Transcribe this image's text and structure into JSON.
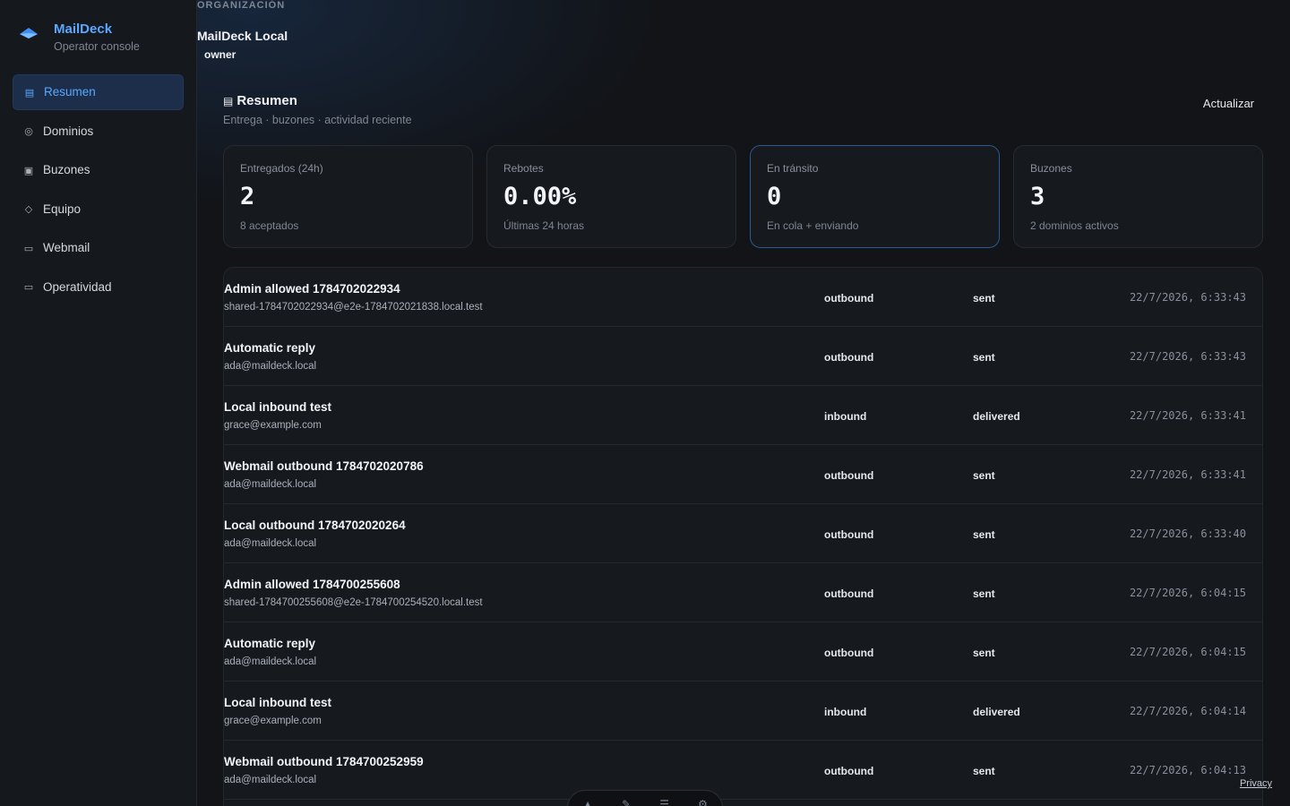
{
  "app": {
    "name": "MailDeck",
    "subtitle": "Operator console",
    "accent": "#5aa8ff"
  },
  "nav": [
    {
      "label": "Resumen",
      "icon": "list-icon",
      "glyph": "▤",
      "active": true
    },
    {
      "label": "Dominios",
      "icon": "globe-icon",
      "glyph": "◎",
      "active": false
    },
    {
      "label": "Buzones",
      "icon": "mailbox-icon",
      "glyph": "▣",
      "active": false
    },
    {
      "label": "Equipo",
      "icon": "team-icon",
      "glyph": "◇",
      "active": false
    },
    {
      "label": "Webmail",
      "icon": "webmail-icon",
      "glyph": "▭",
      "active": false
    },
    {
      "label": "Operatividad",
      "icon": "operations-icon",
      "glyph": "▭",
      "active": false
    }
  ],
  "org": {
    "label": "ORGANIZACIÓN",
    "name": "MailDeck Local",
    "role": "owner"
  },
  "section": {
    "title": "Resumen",
    "subtitle": "Entrega · buzones · actividad reciente",
    "refresh": "Actualizar"
  },
  "cards": [
    {
      "label": "Entregados (24h)",
      "value": "2",
      "note": "8 aceptados"
    },
    {
      "label": "Rebotes",
      "value": "0.00%",
      "note": "Últimas 24 horas"
    },
    {
      "label": "En tránsito",
      "value": "0",
      "note": "En cola + enviando"
    },
    {
      "label": "Buzones",
      "value": "3",
      "note": "2 dominios activos"
    }
  ],
  "messages": [
    {
      "subject": "Admin allowed 1784702022934",
      "from": "shared-1784702022934@e2e-1784702021838.local.test",
      "direction": "outbound",
      "status": "sent",
      "time": "22/7/2026, 6:33:43"
    },
    {
      "subject": "Automatic reply",
      "from": "ada@maildeck.local",
      "direction": "outbound",
      "status": "sent",
      "time": "22/7/2026, 6:33:43"
    },
    {
      "subject": "Local inbound test",
      "from": "grace@example.com",
      "direction": "inbound",
      "status": "delivered",
      "time": "22/7/2026, 6:33:41"
    },
    {
      "subject": "Webmail outbound 1784702020786",
      "from": "ada@maildeck.local",
      "direction": "outbound",
      "status": "sent",
      "time": "22/7/2026, 6:33:41"
    },
    {
      "subject": "Local outbound 1784702020264",
      "from": "ada@maildeck.local",
      "direction": "outbound",
      "status": "sent",
      "time": "22/7/2026, 6:33:40"
    },
    {
      "subject": "Admin allowed 1784700255608",
      "from": "shared-1784700255608@e2e-1784700254520.local.test",
      "direction": "outbound",
      "status": "sent",
      "time": "22/7/2026, 6:04:15"
    },
    {
      "subject": "Automatic reply",
      "from": "ada@maildeck.local",
      "direction": "outbound",
      "status": "sent",
      "time": "22/7/2026, 6:04:15"
    },
    {
      "subject": "Local inbound test",
      "from": "grace@example.com",
      "direction": "inbound",
      "status": "delivered",
      "time": "22/7/2026, 6:04:14"
    },
    {
      "subject": "Webmail outbound 1784700252959",
      "from": "ada@maildeck.local",
      "direction": "outbound",
      "status": "sent",
      "time": "22/7/2026, 6:04:13"
    }
  ],
  "footer": {
    "privacy": "Privacy"
  }
}
